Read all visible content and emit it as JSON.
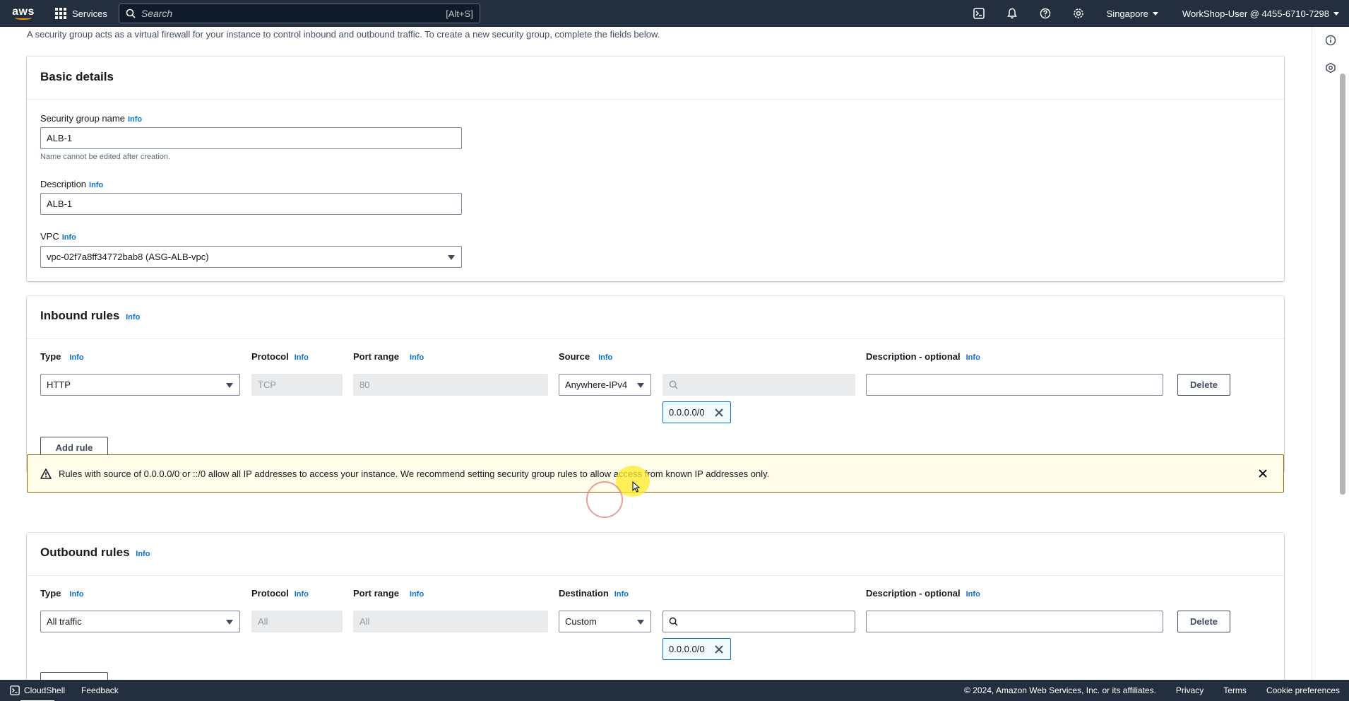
{
  "topnav": {
    "logo_text": "aws",
    "services_label": "Services",
    "search_placeholder": "Search",
    "search_shortcut": "[Alt+S]",
    "region": "Singapore",
    "account": "WorkShop-User @ 4455-6710-7298"
  },
  "intro_text": "A security group acts as a virtual firewall for your instance to control inbound and outbound traffic. To create a new security group, complete the fields below.",
  "basic_details": {
    "title": "Basic details",
    "name_label": "Security group name",
    "name_value": "ALB-1",
    "name_hint": "Name cannot be edited after creation.",
    "description_label": "Description",
    "description_value": "ALB-1",
    "vpc_label": "VPC",
    "vpc_value": "vpc-02f7a8ff34772bab8 (ASG-ALB-vpc)"
  },
  "info": "Info",
  "inbound": {
    "title": "Inbound rules",
    "col_type": "Type",
    "col_protocol": "Protocol",
    "col_port": "Port range",
    "col_source": "Source",
    "col_desc": "Description - optional",
    "rule": {
      "type": "HTTP",
      "protocol": "TCP",
      "port": "80",
      "source": "Anywhere-IPv4",
      "cidr_token": "0.0.0.0/0",
      "description": ""
    },
    "delete_label": "Delete",
    "add_rule_label": "Add rule"
  },
  "warning": {
    "text": "Rules with source of 0.0.0.0/0 or ::/0 allow all IP addresses to access your instance. We recommend setting security group rules to allow access from known IP addresses only.",
    "color": "#906806"
  },
  "outbound": {
    "title": "Outbound rules",
    "col_type": "Type",
    "col_protocol": "Protocol",
    "col_port": "Port range",
    "col_destination": "Destination",
    "col_desc": "Description - optional",
    "rule": {
      "type": "All traffic",
      "protocol": "All",
      "port": "All",
      "destination": "Custom",
      "cidr_token": "0.0.0.0/0",
      "description": ""
    },
    "delete_label": "Delete"
  },
  "footer": {
    "cloudshell": "CloudShell",
    "feedback": "Feedback",
    "copyright": "© 2024, Amazon Web Services, Inc. or its affiliates.",
    "privacy": "Privacy",
    "terms": "Terms",
    "cookies": "Cookie preferences"
  },
  "colors": {
    "nav_bg": "#232f3e",
    "link": "#0972d3",
    "warning_bg": "#fffce9"
  }
}
